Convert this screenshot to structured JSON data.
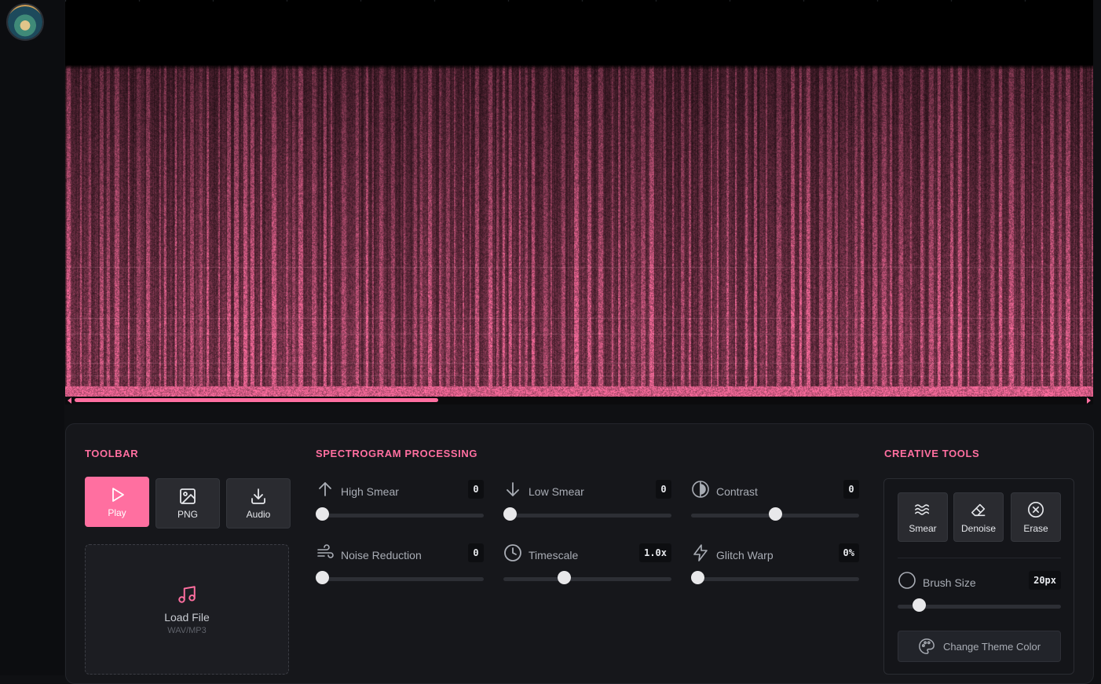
{
  "colors": {
    "accent": "#ff6fa0",
    "panel": "#16171b",
    "background": "#0f1013"
  },
  "toolbar": {
    "title": "TOOLBAR",
    "buttons": [
      {
        "label": "Play",
        "icon": "play-icon",
        "active": true
      },
      {
        "label": "PNG",
        "icon": "image-icon"
      },
      {
        "label": "Audio",
        "icon": "download-icon"
      }
    ],
    "load": {
      "title": "Load File",
      "formats": "WAV/MP3",
      "icon": "music-note-icon"
    }
  },
  "processing": {
    "title": "SPECTROGRAM PROCESSING",
    "controls": [
      {
        "label": "High Smear",
        "value": "0",
        "icon": "arrow-up-icon",
        "position": 0.0
      },
      {
        "label": "Low Smear",
        "value": "0",
        "icon": "arrow-down-icon",
        "position": 0.0
      },
      {
        "label": "Contrast",
        "value": "0",
        "icon": "contrast-icon",
        "position": 0.5
      },
      {
        "label": "Noise Reduction",
        "value": "0",
        "icon": "wind-icon",
        "position": 0.0
      },
      {
        "label": "Timescale",
        "value": "1.0x",
        "icon": "clock-icon",
        "position": 0.35
      },
      {
        "label": "Glitch Warp",
        "value": "0%",
        "icon": "lightning-icon",
        "position": 0.0
      }
    ]
  },
  "creative": {
    "title": "CREATIVE TOOLS",
    "tools": [
      {
        "label": "Smear",
        "icon": "waves-icon"
      },
      {
        "label": "Denoise",
        "icon": "eraser-icon"
      },
      {
        "label": "Erase",
        "icon": "close-circle-icon"
      }
    ],
    "brush": {
      "label": "Brush Size",
      "value": "20px",
      "position": 0.1
    },
    "theme_label": "Change Theme Color"
  },
  "viewer": {
    "scroll_position": 0.0,
    "scroll_visible_fraction": 0.36
  }
}
